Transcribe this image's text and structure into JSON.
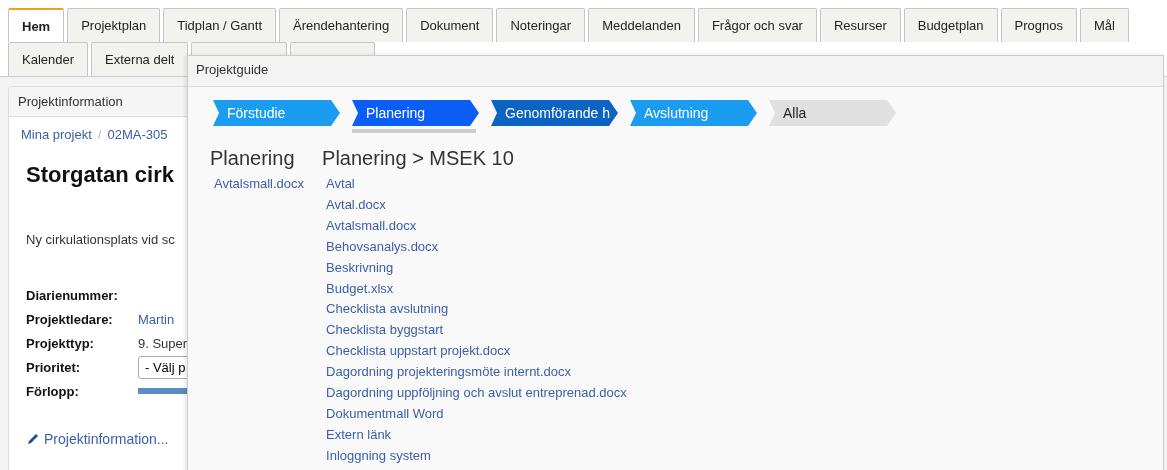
{
  "tabs_row_1": [
    {
      "label": "Hem",
      "selected": true
    },
    {
      "label": "Projektplan",
      "selected": false
    },
    {
      "label": "Tidplan / Gantt",
      "selected": false
    },
    {
      "label": "Ärendehantering",
      "selected": false
    },
    {
      "label": "Dokument",
      "selected": false
    },
    {
      "label": "Noteringar",
      "selected": false
    },
    {
      "label": "Meddelanden",
      "selected": false
    },
    {
      "label": "Frågor och svar",
      "selected": false
    },
    {
      "label": "Resurser",
      "selected": false
    },
    {
      "label": "Budgetplan",
      "selected": false
    },
    {
      "label": "Prognos",
      "selected": false
    },
    {
      "label": "Mål",
      "selected": false
    }
  ],
  "tabs_row_2": [
    {
      "label": "Kalender",
      "selected": false
    },
    {
      "label": "Externa delt",
      "selected": false
    }
  ],
  "panel": {
    "title": "Projektinformation",
    "breadcrumb": [
      "Mina projekt",
      "/",
      "02MA-305"
    ],
    "heading": "Storgatan cirk",
    "description": "Ny cirkulationsplats vid sc",
    "fields": [
      {
        "kind": "text",
        "label": "Diarienummer:"
      },
      {
        "kind": "link",
        "label": "Projektledare:",
        "value": "Martin"
      },
      {
        "kind": "text",
        "label": "Projekttyp:",
        "value": "9. Super"
      },
      {
        "kind": "select",
        "label": "Prioritet:",
        "value": "- Välj p"
      },
      {
        "kind": "progress",
        "label": "Förlopp:",
        "level": 1
      }
    ],
    "edit_link": "Projektinformation..."
  },
  "dialog": {
    "title": "Projektguide",
    "steps": [
      {
        "label": "Förstudie",
        "color": "#1a9cf0",
        "selected": false
      },
      {
        "label": "Planering",
        "color": "#0a5ef5",
        "selected": true
      },
      {
        "label": "Genomförande h",
        "color": "#0b63c4",
        "selected": false
      },
      {
        "label": "Avslutning",
        "color": "#1a9cf0",
        "selected": false
      },
      {
        "label": "Alla",
        "color": "#e0e0e0",
        "selected": false
      }
    ],
    "left": {
      "heading": "Planering",
      "links": [
        "Avtalsmall.docx"
      ]
    },
    "right": {
      "heading": "Planering > MSEK 10",
      "links": [
        "Avtal",
        "Avtal.docx",
        "Avtalsmall.docx",
        "Behovsanalys.docx",
        "Beskrivning",
        "Budget.xlsx",
        "Checklista avslutning",
        "Checklista byggstart",
        "Checklista uppstart projekt.docx",
        "Dagordning projekteringsmöte internt.docx",
        "Dagordning uppföljning och avslut entreprenad.docx",
        "Dokumentmall Word",
        "Extern länk",
        "Inloggning system"
      ]
    }
  }
}
